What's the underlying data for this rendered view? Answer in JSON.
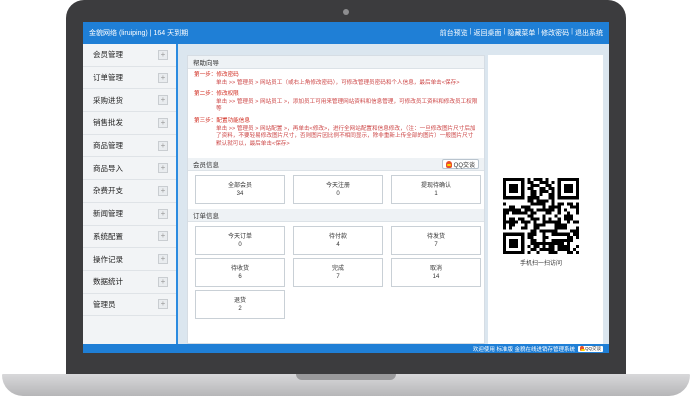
{
  "header": {
    "title": "金貌网络 (liruiping) | 164 天到期",
    "nav": [
      "前台预览",
      "返回桌面",
      "隐藏菜单",
      "修改密码",
      "退出系统"
    ]
  },
  "sidebar": {
    "items": [
      {
        "label": "会员管理"
      },
      {
        "label": "订单管理"
      },
      {
        "label": "采购进货"
      },
      {
        "label": "销售批发"
      },
      {
        "label": "商品管理"
      },
      {
        "label": "商品导入"
      },
      {
        "label": "杂费开支"
      },
      {
        "label": "新闻管理"
      },
      {
        "label": "系统配置"
      },
      {
        "label": "操作记录"
      },
      {
        "label": "数据统计"
      },
      {
        "label": "管理员"
      }
    ]
  },
  "help": {
    "title": "帮助向导",
    "steps": [
      {
        "step": "第一步：修改密码",
        "desc": "单击 >> 管理员 > 网站员工（或右上角修改密码），可修改管理员密码和个人信息，最后单击<保存>"
      },
      {
        "step": "第二步：修改权限",
        "desc": "单击 >> 管理员 > 网站员工 >，添加员工可用来管理网站资料和信息管理，可修改员工资料和修改员工权限等"
      },
      {
        "step": "第三步：配置功能信息",
        "desc": "单击 >> 管理员 > 网站配置 >，再单击<修改>，进行全网站配置和信息修改，（注：一旦修改图片尺寸后加了资料，不要轻易修改图片尺寸，否则图片因比例不相同显示，除非重新上传全部的图片）一般图片尺寸默认就可以，最后单击<保存>"
      }
    ]
  },
  "members": {
    "title": "会员信息",
    "qq_label": "QQ交谈",
    "stats": [
      {
        "label": "全部会员",
        "value": "34"
      },
      {
        "label": "今天注册",
        "value": "0"
      },
      {
        "label": "提现待确认",
        "value": "1"
      }
    ]
  },
  "orders": {
    "title": "订单信息",
    "stats": [
      {
        "label": "今天订单",
        "value": "0"
      },
      {
        "label": "待付款",
        "value": "4"
      },
      {
        "label": "待发货",
        "value": "7"
      },
      {
        "label": "待收货",
        "value": "6"
      },
      {
        "label": "完成",
        "value": "7"
      },
      {
        "label": "取消",
        "value": "14"
      },
      {
        "label": "退货",
        "value": "2"
      }
    ]
  },
  "qr": {
    "caption": "手机扫一扫访问"
  },
  "footer": {
    "text": "欢迎使用 标准版 金貌在线进销存管理系统",
    "qq_label": "QQ交谈"
  },
  "colors": {
    "brand": "#1f7fd6",
    "step_red": "#d0281c"
  }
}
